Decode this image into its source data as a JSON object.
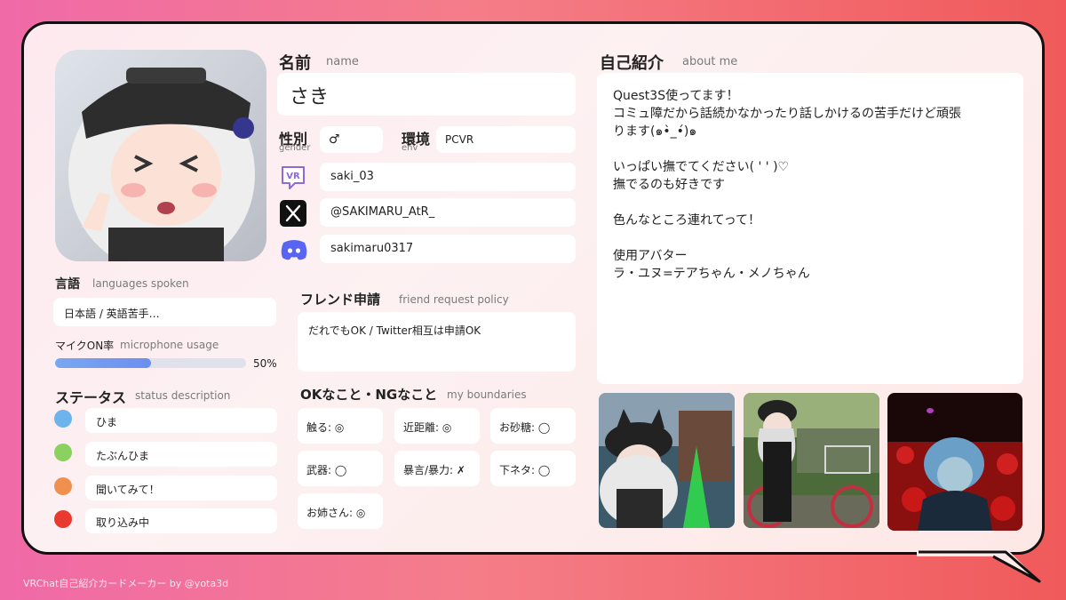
{
  "name_section": {
    "title": "名前",
    "subtitle": "name",
    "value": "さき"
  },
  "gender": {
    "title": "性別",
    "subtitle": "gender",
    "value": "♂"
  },
  "env": {
    "title": "環境",
    "subtitle": "env",
    "value": "PCVR"
  },
  "accounts": {
    "vrchat": {
      "icon": "vrchat-icon",
      "value": "saki_03"
    },
    "x": {
      "icon": "x-logo-icon",
      "value": "@SAKIMARU_AtR_"
    },
    "discord": {
      "icon": "discord-icon",
      "value": "sakimaru0317"
    }
  },
  "languages": {
    "title": "言語",
    "subtitle": "languages spoken",
    "value": "日本語 / 英語苦手…"
  },
  "mic": {
    "title": "マイクON率",
    "subtitle": "microphone usage",
    "percent": 50,
    "label": "50%"
  },
  "status": {
    "title": "ステータス",
    "subtitle": "status description",
    "items": [
      {
        "color": "#6db3ec",
        "label": "ひま"
      },
      {
        "color": "#8bd160",
        "label": "たぶんひま"
      },
      {
        "color": "#f0904f",
        "label": "聞いてみて！"
      },
      {
        "color": "#e83a2e",
        "label": "取り込み中"
      }
    ]
  },
  "friend": {
    "title": "フレンド申請",
    "subtitle": "friend request policy",
    "value": "だれでもOK / Twitter相互は申請OK"
  },
  "boundaries": {
    "title": "OKなこと・NGなこと",
    "subtitle": "my boundaries",
    "items": [
      "触る: ◎",
      "近距離: ◎",
      "お砂糖: ◯",
      "武器: ◯",
      "暴言/暴力: ✗",
      "下ネタ: ◯",
      "お姉さん: ◎"
    ]
  },
  "about": {
    "title": "自己紹介",
    "subtitle": "about me",
    "lines": [
      "Quest3S使ってます！",
      "コミュ障だから話続かなかったり話しかけるの苦手だけど頑張",
      "ります(๑•̀_•́)๑",
      "",
      "いっぱい撫でてください( ' ' )♡",
      "撫でるのも好きです",
      "",
      "色んなところ連れてって！",
      "",
      "使用アバター",
      "ラ・ユヌ=テアちゃん・メノちゃん"
    ]
  },
  "footer": "VRChat自己紹介カードメーカー by @yota3d"
}
